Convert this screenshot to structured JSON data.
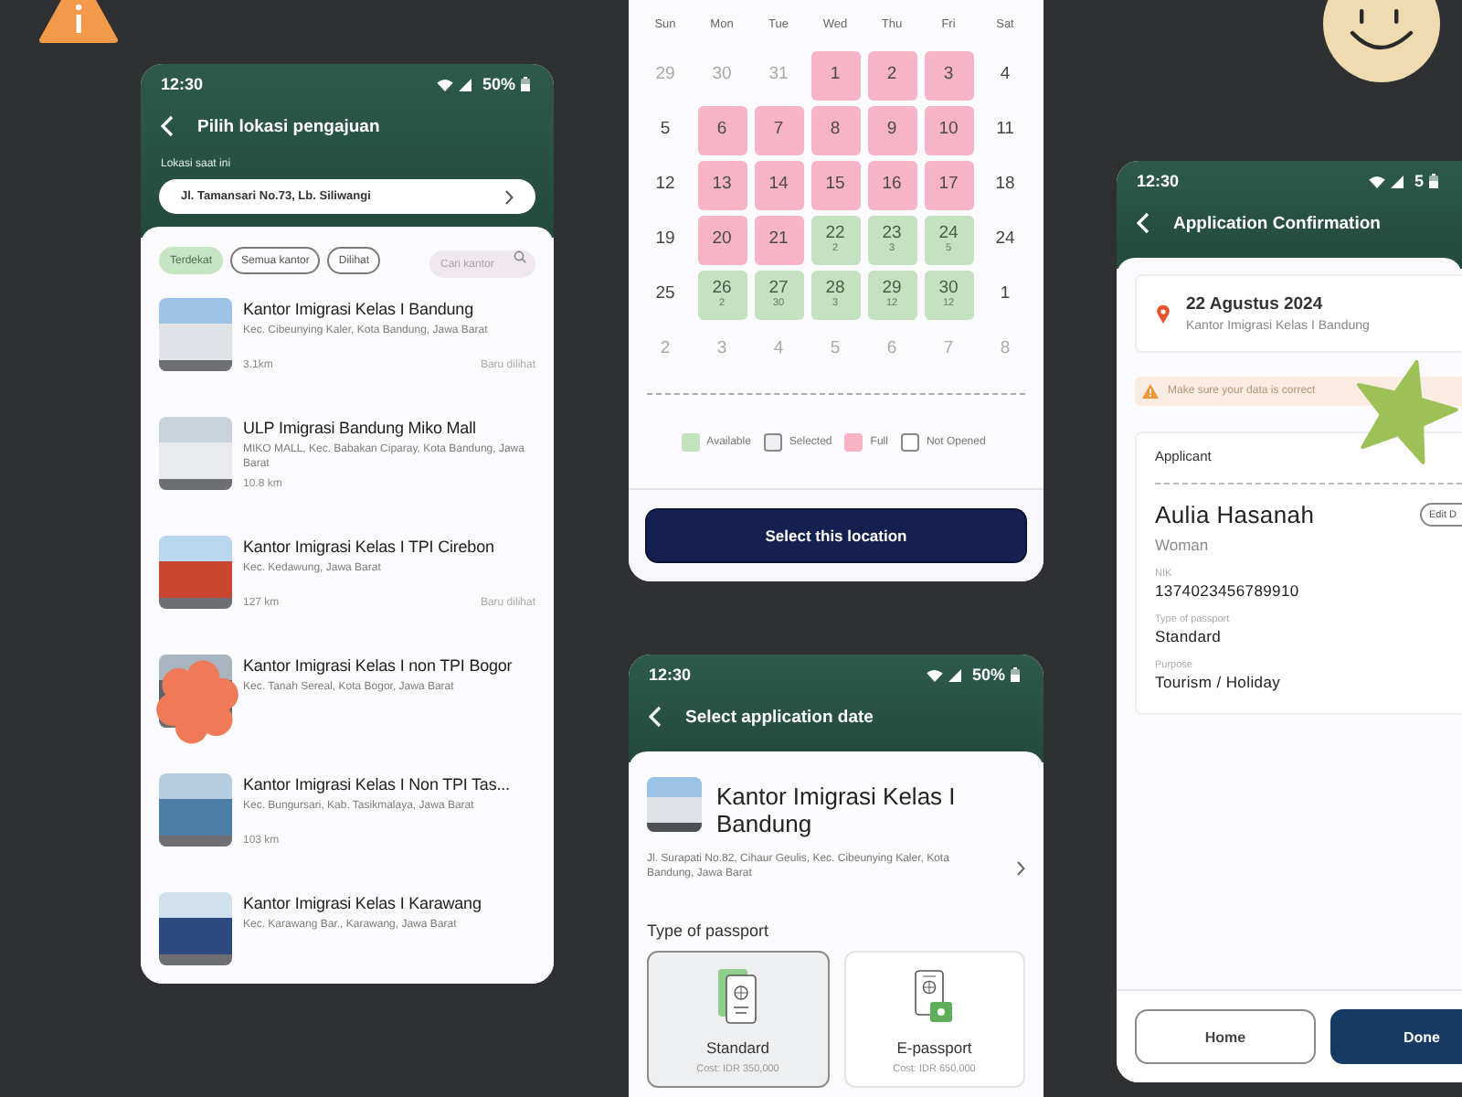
{
  "location_screen": {
    "status_bar": {
      "time": "12:30",
      "battery": "50%"
    },
    "title": "Pilih lokasi pengajuan",
    "current_location_label": "Lokasi saat ini",
    "current_location": "Jl. Tamansari No.73, Lb. Siliwangi",
    "filters": [
      {
        "label": "Terdekat",
        "selected": true
      },
      {
        "label": "Semua kantor",
        "selected": false
      },
      {
        "label": "Dilihat",
        "selected": false
      }
    ],
    "search": {
      "placeholder": "Cari kantor"
    },
    "offices": [
      {
        "name": "Kantor Imigrasi Kelas I Bandung",
        "address": "Kec. Cibeunying Kaler, Kota Bandung, Jawa Barat",
        "distance": "3.1km",
        "note": "Baru dilihat"
      },
      {
        "name": "ULP Imigrasi Bandung Miko Mall",
        "address": "MIKO MALL, Kec. Babakan Ciparay, Kota Bandung, Jawa Barat",
        "distance": "10.8 km"
      },
      {
        "name": "Kantor Imigrasi Kelas I TPI Cirebon",
        "address": "Kec. Kedawung, Jawa Barat",
        "distance": "127 km",
        "note": "Baru dilihat"
      },
      {
        "name": "Kantor Imigrasi Kelas I non TPI Bogor",
        "address": "Kec. Tanah Sereal, Kota Bogor, Jawa Barat"
      },
      {
        "name": "Kantor Imigrasi Kelas I Non TPI Tas...",
        "address": "Kec. Bungursari, Kab. Tasikmalaya, Jawa Barat",
        "distance": "103 km"
      },
      {
        "name": "Kantor Imigrasi Kelas I Karawang",
        "address": "Kec. Karawang Bar., Karawang, Jawa Barat"
      }
    ]
  },
  "calendar_screen": {
    "weekdays": [
      "Sun",
      "Mon",
      "Tue",
      "Wed",
      "Thu",
      "Fri",
      "Sat"
    ],
    "weeks": [
      [
        {
          "day": "29",
          "kind": "outside"
        },
        {
          "day": "30",
          "kind": "outside"
        },
        {
          "day": "31",
          "kind": "outside"
        },
        {
          "day": "1",
          "kind": "full"
        },
        {
          "day": "2",
          "kind": "full"
        },
        {
          "day": "3",
          "kind": "full"
        },
        {
          "day": "4",
          "kind": "closed"
        }
      ],
      [
        {
          "day": "5",
          "kind": "closed"
        },
        {
          "day": "6",
          "kind": "full"
        },
        {
          "day": "7",
          "kind": "full"
        },
        {
          "day": "8",
          "kind": "full"
        },
        {
          "day": "9",
          "kind": "full"
        },
        {
          "day": "10",
          "kind": "full"
        },
        {
          "day": "11",
          "kind": "closed"
        }
      ],
      [
        {
          "day": "12",
          "kind": "closed"
        },
        {
          "day": "13",
          "kind": "full"
        },
        {
          "day": "14",
          "kind": "full"
        },
        {
          "day": "15",
          "kind": "full"
        },
        {
          "day": "16",
          "kind": "full"
        },
        {
          "day": "17",
          "kind": "full"
        },
        {
          "day": "18",
          "kind": "closed"
        }
      ],
      [
        {
          "day": "19",
          "kind": "closed"
        },
        {
          "day": "20",
          "kind": "full"
        },
        {
          "day": "21",
          "kind": "full"
        },
        {
          "day": "22",
          "kind": "available",
          "count": "2"
        },
        {
          "day": "23",
          "kind": "available",
          "count": "3"
        },
        {
          "day": "24",
          "kind": "available",
          "count": "5"
        },
        {
          "day": "24",
          "kind": "closed"
        }
      ],
      [
        {
          "day": "25",
          "kind": "closed"
        },
        {
          "day": "26",
          "kind": "available",
          "count": "2"
        },
        {
          "day": "27",
          "kind": "available",
          "count": "30"
        },
        {
          "day": "28",
          "kind": "available",
          "count": "3"
        },
        {
          "day": "29",
          "kind": "available",
          "count": "12"
        },
        {
          "day": "30",
          "kind": "available",
          "count": "12"
        },
        {
          "day": "1",
          "kind": "closed"
        }
      ],
      [
        {
          "day": "2",
          "kind": "outside"
        },
        {
          "day": "3",
          "kind": "outside"
        },
        {
          "day": "4",
          "kind": "outside"
        },
        {
          "day": "5",
          "kind": "outside"
        },
        {
          "day": "6",
          "kind": "outside"
        },
        {
          "day": "7",
          "kind": "outside"
        },
        {
          "day": "8",
          "kind": "outside"
        }
      ]
    ],
    "legend": [
      {
        "label": "Available",
        "kind": "available"
      },
      {
        "label": "Selected",
        "kind": "selected"
      },
      {
        "label": "Full",
        "kind": "full"
      },
      {
        "label": "Not Opened",
        "kind": "not_opened"
      }
    ],
    "button": "Select this location"
  },
  "date_screen": {
    "status_bar": {
      "time": "12:30",
      "battery": "50%"
    },
    "title": "Select application date",
    "office": {
      "name": "Kantor Imigrasi Kelas I Bandung",
      "address": "Jl. Surapati No.82, Cihaur Geulis, Kec. Cibeunying Kaler, Kota Bandung, Jawa Barat"
    },
    "passport_label": "Type of passport",
    "passport_types": [
      {
        "name": "Standard",
        "cost": "Cost: IDR 350,000",
        "kind": "standard",
        "selected": true
      },
      {
        "name": "E-passport",
        "cost": "Cost: IDR 650,000",
        "kind": "electronic",
        "selected": false
      }
    ]
  },
  "confirmation_screen": {
    "status_bar": {
      "time": "12:30",
      "battery": "5"
    },
    "title": "Application Confirmation",
    "appointment": {
      "date": "22 Agustus 2024",
      "office": "Kantor Imigrasi Kelas I Bandung"
    },
    "warning": "Make sure your data is correct",
    "applicant": {
      "heading": "Applicant",
      "name": "Aulia Hasanah",
      "gender": "Woman",
      "edit_button": "Edit D",
      "fields": [
        {
          "label": "NIK",
          "value": "1374023456789910"
        },
        {
          "label": "Type of passport",
          "value": "Standard"
        },
        {
          "label": "Purpose",
          "value": "Tourism / Holiday"
        }
      ]
    },
    "buttons": [
      {
        "label": "Home",
        "kind": "secondary"
      },
      {
        "label": "Done",
        "kind": "primary"
      }
    ]
  }
}
